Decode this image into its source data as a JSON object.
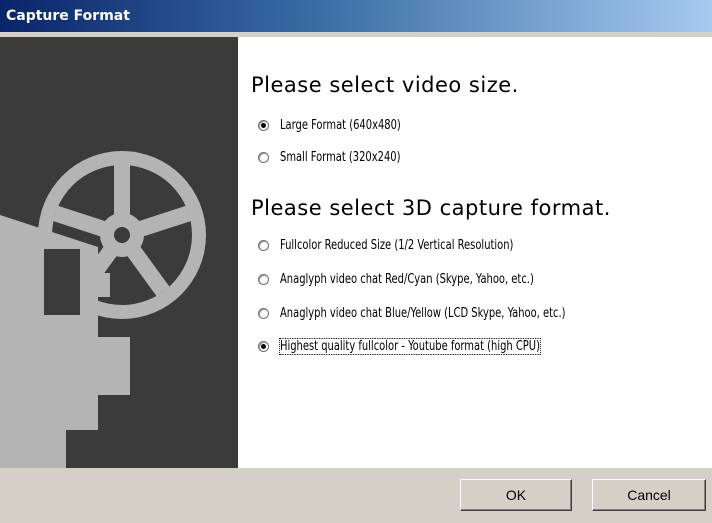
{
  "window": {
    "title": "Capture Format"
  },
  "video_size": {
    "heading": "Please select video size.",
    "options": [
      {
        "label": "Large Format (640x480)",
        "selected": true
      },
      {
        "label": "Small Format (320x240)",
        "selected": false
      }
    ]
  },
  "capture_format": {
    "heading": "Please select 3D capture format.",
    "options": [
      {
        "label": "Fullcolor Reduced Size (1/2 Vertical Resolution)",
        "selected": false
      },
      {
        "label": "Anaglyph video chat Red/Cyan (Skype, Yahoo, etc.)",
        "selected": false
      },
      {
        "label": "Anaglyph video chat Blue/Yellow (LCD Skype, Yahoo, etc.)",
        "selected": false
      },
      {
        "label": "Highest quality fullcolor - Youtube format (high CPU)",
        "selected": true
      }
    ]
  },
  "buttons": {
    "ok": "OK",
    "cancel": "Cancel"
  },
  "sidebar": {
    "illustration": "film-projector-icon"
  },
  "colors": {
    "sidebar_bg": "#3b3b3b",
    "illustration": "#b4b4b4",
    "footer_bg": "#d4d0c8",
    "title_bar": "#0a246a"
  }
}
